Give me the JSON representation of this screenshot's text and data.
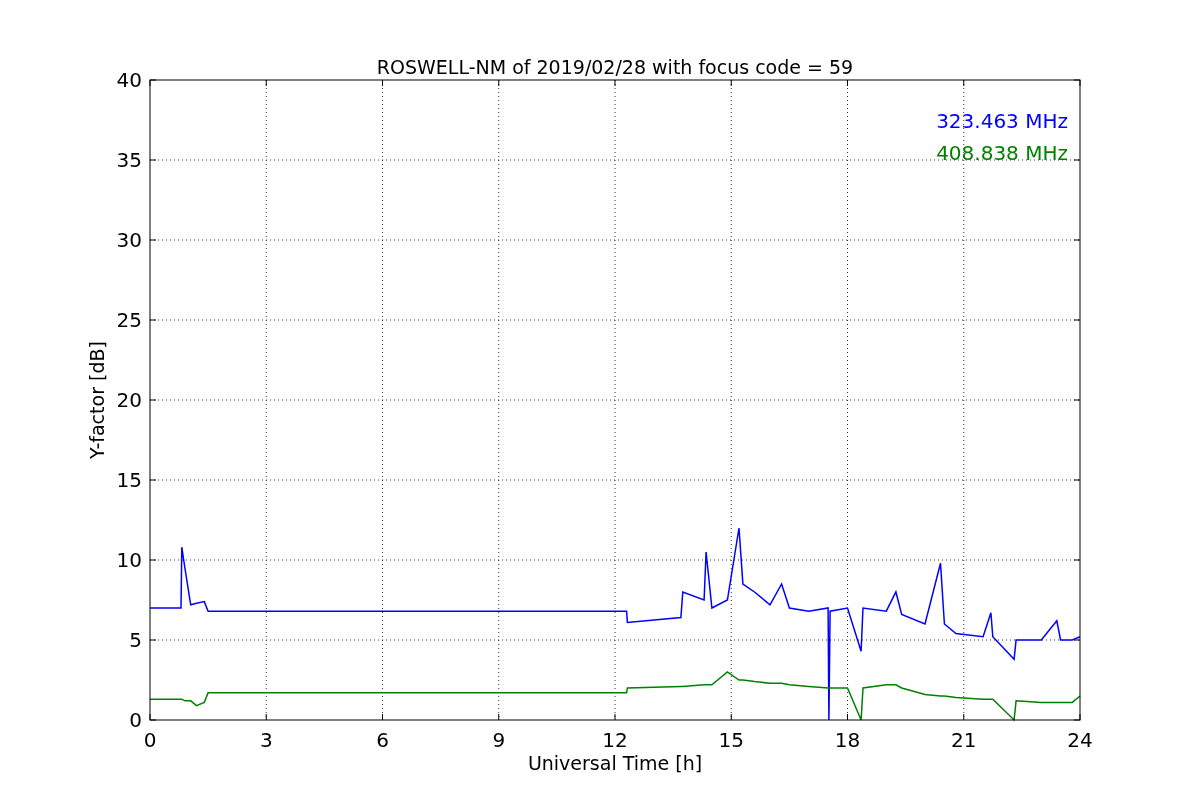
{
  "chart_data": {
    "type": "line",
    "title": "ROSWELL-NM of 2019/02/28 with focus code = 59",
    "xlabel": "Universal Time [h]",
    "ylabel": "Y-factor [dB]",
    "x": [
      0,
      0.8,
      0.82,
      0.9,
      1.05,
      1.2,
      1.4,
      1.5,
      12.3,
      12.32,
      13.7,
      13.75,
      14.3,
      14.35,
      14.5,
      14.9,
      15.2,
      15.3,
      15.6,
      16.0,
      16.3,
      16.5,
      17.0,
      17.5,
      17.52,
      17.55,
      18.0,
      18.35,
      18.4,
      19.0,
      19.25,
      19.4,
      20.0,
      20.4,
      20.5,
      20.8,
      21.5,
      21.7,
      21.75,
      22.3,
      22.35,
      23.0,
      23.4,
      23.5,
      23.8,
      24
    ],
    "series": [
      {
        "name": "323.463 MHz",
        "color": "#0000ff",
        "values": [
          7.0,
          7.0,
          10.8,
          9.5,
          7.2,
          7.3,
          7.4,
          6.8,
          6.8,
          6.1,
          6.4,
          8.0,
          7.5,
          10.5,
          7.0,
          7.5,
          12.0,
          8.5,
          8.0,
          7.2,
          8.5,
          7.0,
          6.8,
          7.0,
          0,
          6.8,
          7.0,
          4.3,
          7.0,
          6.8,
          8.0,
          6.6,
          6.0,
          9.8,
          6.0,
          5.4,
          5.2,
          6.7,
          5.2,
          3.8,
          5.0,
          5.0,
          6.2,
          5.0,
          5.0,
          5.2
        ]
      },
      {
        "name": "408.838 MHz",
        "color": "#008000",
        "values": [
          1.3,
          1.3,
          1.3,
          1.2,
          1.2,
          0.9,
          1.1,
          1.7,
          1.7,
          2.0,
          2.1,
          2.1,
          2.2,
          2.2,
          2.2,
          3.0,
          2.5,
          2.5,
          2.4,
          2.3,
          2.3,
          2.2,
          2.1,
          2.0,
          2.0,
          2.0,
          2.0,
          0,
          2.0,
          2.2,
          2.2,
          2.0,
          1.6,
          1.5,
          1.5,
          1.4,
          1.3,
          1.3,
          1.3,
          0,
          1.2,
          1.1,
          1.1,
          1.1,
          1.1,
          1.5
        ]
      }
    ],
    "grid": true,
    "xlim": [
      0,
      24
    ],
    "ylim": [
      0,
      40
    ],
    "xticks": [
      0,
      3,
      6,
      9,
      12,
      15,
      18,
      21,
      24
    ],
    "yticks": [
      0,
      5,
      10,
      15,
      20,
      25,
      30,
      35,
      40
    ]
  }
}
